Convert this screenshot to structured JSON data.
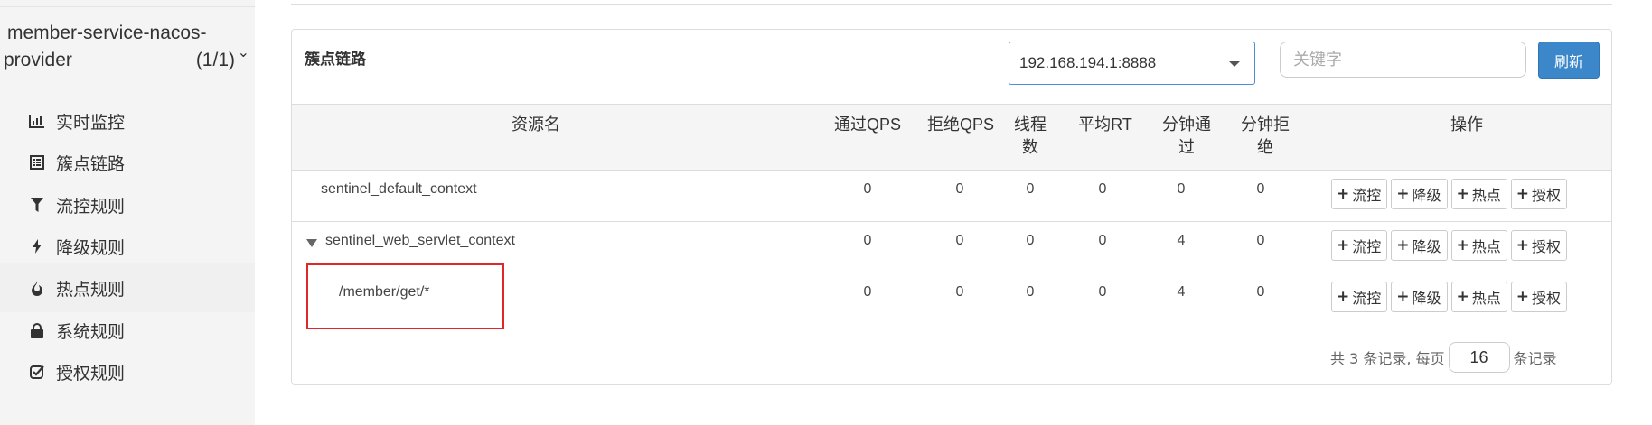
{
  "sidebar": {
    "app_name_line1": "member-service-nacos-",
    "app_name_line2": "provider",
    "app_count": "(1/1)",
    "items": [
      {
        "label": "实时监控",
        "icon": "bar-chart-icon"
      },
      {
        "label": "簇点链路",
        "icon": "list-icon"
      },
      {
        "label": "流控规则",
        "icon": "filter-icon"
      },
      {
        "label": "降级规则",
        "icon": "flash-icon"
      },
      {
        "label": "热点规则",
        "icon": "fire-icon"
      },
      {
        "label": "系统规则",
        "icon": "lock-icon"
      },
      {
        "label": "授权规则",
        "icon": "check-square-icon"
      }
    ]
  },
  "panel": {
    "title": "簇点链路",
    "machine": "192.168.194.1:8888",
    "keyword_placeholder": "关键字",
    "refresh_label": "刷新"
  },
  "table": {
    "headers": {
      "resource": "资源名",
      "pass_qps": "通过QPS",
      "block_qps": "拒绝QPS",
      "threads_a": "线程",
      "threads_b": "数",
      "avg_rt": "平均RT",
      "minute_pass_a": "分钟通",
      "minute_pass_b": "过",
      "minute_block_a": "分钟拒",
      "minute_block_b": "绝",
      "actions": "操作"
    },
    "action_labels": {
      "flow": "流控",
      "degrade": "降级",
      "hot": "热点",
      "auth": "授权"
    },
    "rows": [
      {
        "resource": "sentinel_default_context",
        "pass_qps": "0",
        "block_qps": "0",
        "threads": "0",
        "avg_rt": "0",
        "minute_pass": "0",
        "minute_block": "0"
      },
      {
        "resource": "sentinel_web_servlet_context",
        "pass_qps": "0",
        "block_qps": "0",
        "threads": "0",
        "avg_rt": "0",
        "minute_pass": "4",
        "minute_block": "0"
      },
      {
        "resource": "/member/get/*",
        "pass_qps": "0",
        "block_qps": "0",
        "threads": "0",
        "avg_rt": "0",
        "minute_pass": "4",
        "minute_block": "0"
      }
    ]
  },
  "pager": {
    "prefix": "共 3 条记录, 每页",
    "page_size": "16",
    "suffix": "条记录"
  },
  "colors": {
    "primary": "#3b87c9",
    "highlight": "#e0282a"
  }
}
